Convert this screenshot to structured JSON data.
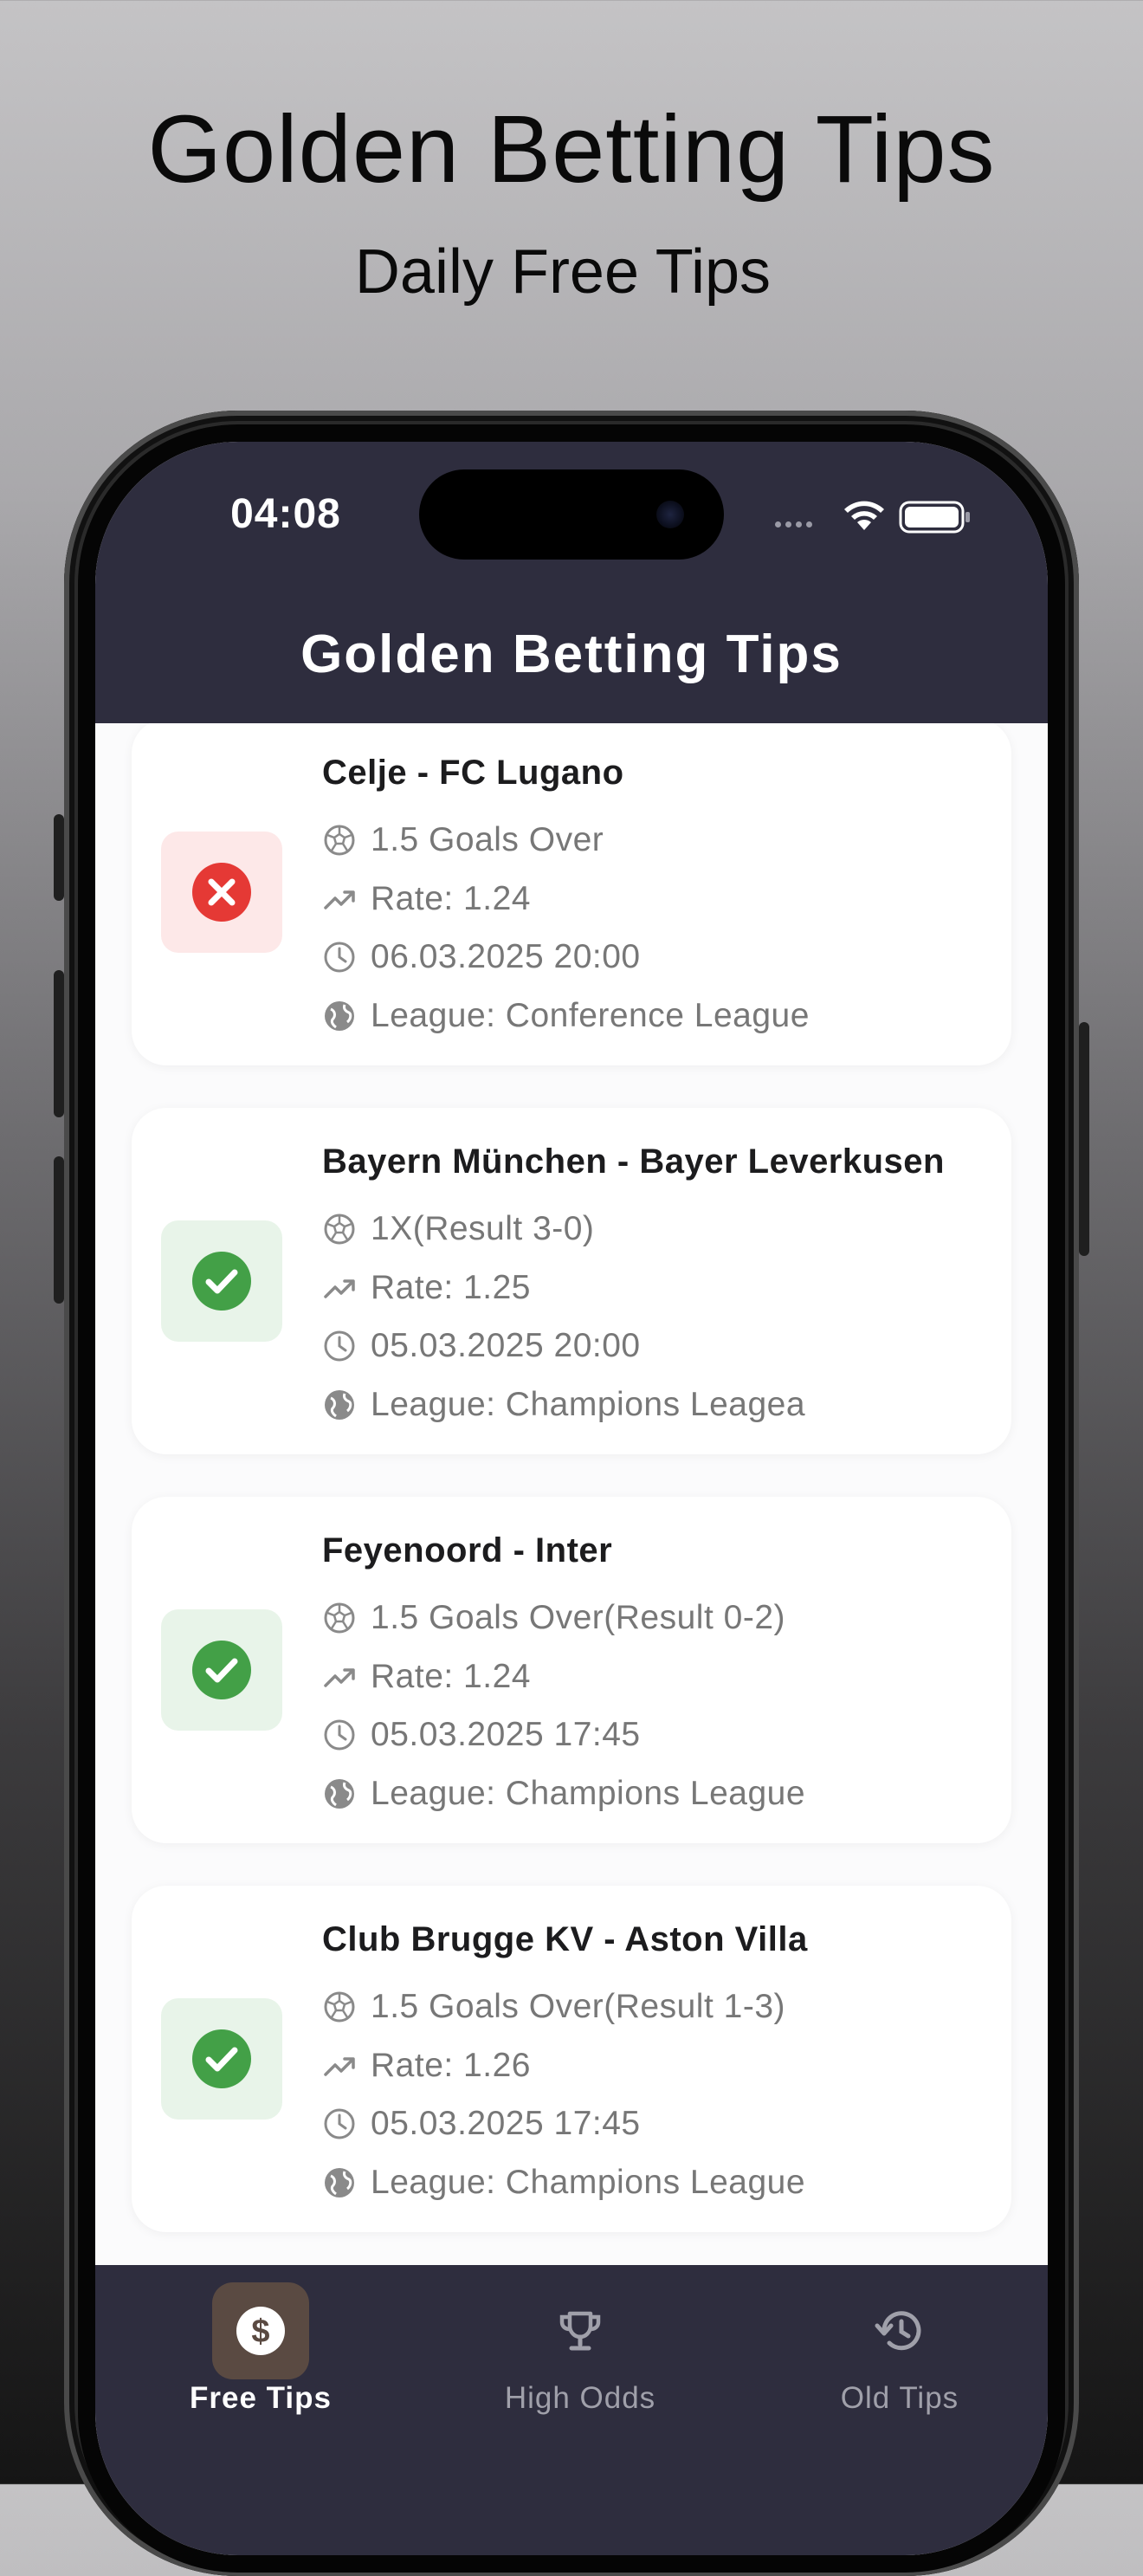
{
  "promo": {
    "title": "Golden Betting Tips",
    "subtitle": "Daily Free Tips"
  },
  "status_bar": {
    "time": "04:08"
  },
  "app": {
    "title": "Golden Betting Tips"
  },
  "tips": [
    {
      "match": "Celje - FC Lugano",
      "prediction": "1.5 Goals Over",
      "rate": "Rate: 1.24",
      "datetime": "06.03.2025 20:00",
      "league": "League: Conference League",
      "result": "lost"
    },
    {
      "match": "Bayern München - Bayer Leverkusen",
      "prediction": "1X(Result 3-0)",
      "rate": "Rate: 1.25",
      "datetime": "05.03.2025 20:00",
      "league": "League: Champions Leagea",
      "result": "won"
    },
    {
      "match": "Feyenoord - Inter",
      "prediction": "1.5 Goals Over(Result 0-2)",
      "rate": "Rate: 1.24",
      "datetime": "05.03.2025 17:45",
      "league": "League: Champions League",
      "result": "won"
    },
    {
      "match": "Club Brugge KV - Aston Villa",
      "prediction": "1.5 Goals Over(Result 1-3)",
      "rate": "Rate: 1.26",
      "datetime": "05.03.2025 17:45",
      "league": "League: Champions League",
      "result": "won"
    }
  ],
  "tabs": [
    {
      "label": "Free Tips",
      "icon": "dollar-circle-icon",
      "active": true
    },
    {
      "label": "High Odds",
      "icon": "trophy-icon",
      "active": false
    },
    {
      "label": "Old Tips",
      "icon": "history-icon",
      "active": false
    }
  ],
  "colors": {
    "header_bg": "#2e2d3e",
    "won": "#43a047",
    "lost": "#e53935",
    "active_tab_bg": "#5a4a42"
  }
}
